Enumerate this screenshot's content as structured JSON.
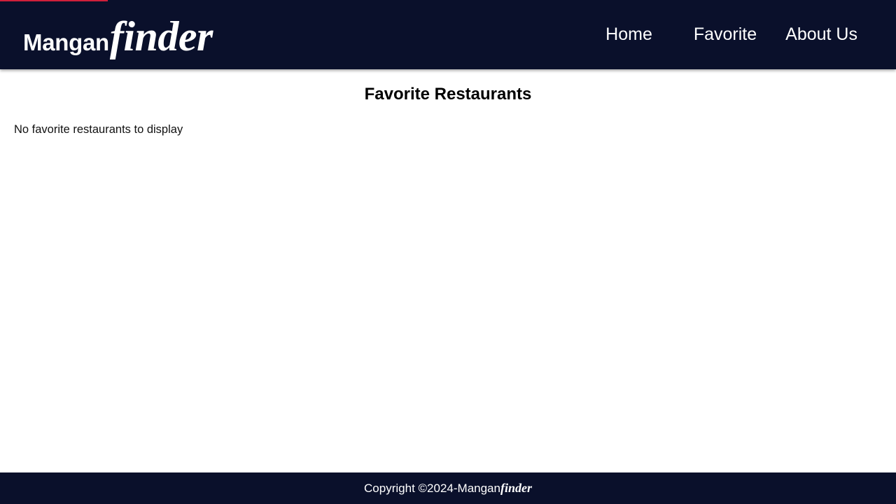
{
  "colors": {
    "header_bg": "#0a102b",
    "footer_bg": "#0a102b",
    "loading_bar": "#d01f3a",
    "text_light": "#ffffff",
    "text_dark": "#000000"
  },
  "loading_bar": {
    "progress_fraction": 0.12
  },
  "header": {
    "brand": {
      "main": "Mangan",
      "accent": "finder"
    },
    "nav": [
      {
        "label": "Home"
      },
      {
        "label": "Favorite"
      },
      {
        "label": "About Us"
      }
    ]
  },
  "main": {
    "title": "Favorite Restaurants",
    "empty_message": "No favorite restaurants to display"
  },
  "footer": {
    "copyright": "Copyright ©2024-",
    "brand_main": "Mangan",
    "brand_accent": "finder"
  }
}
